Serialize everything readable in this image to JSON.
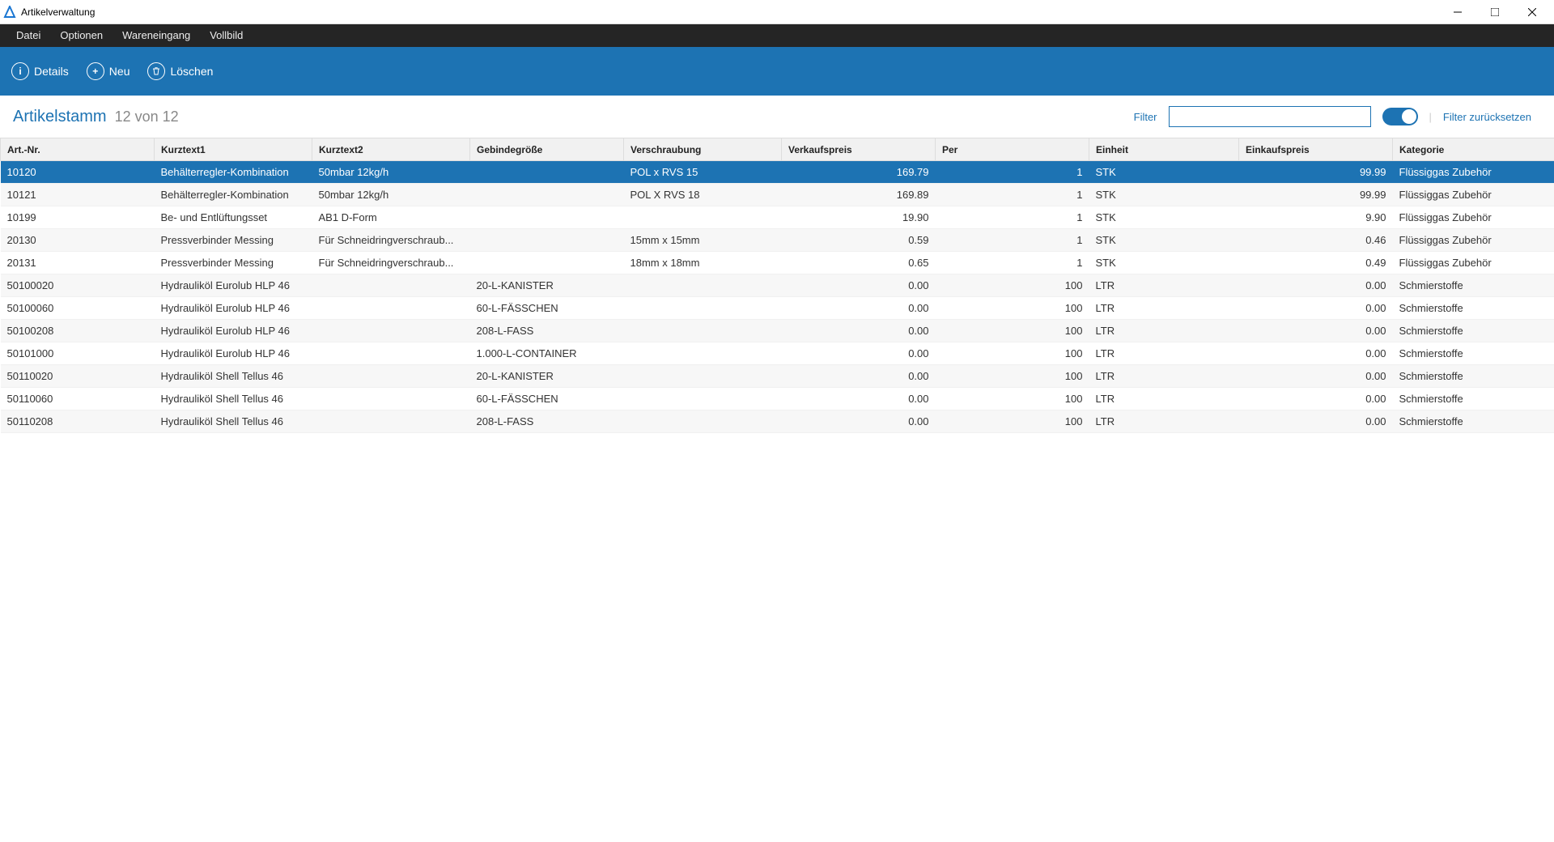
{
  "window": {
    "title": "Artikelverwaltung"
  },
  "menu": [
    "Datei",
    "Optionen",
    "Wareneingang",
    "Vollbild"
  ],
  "toolbar": {
    "details": "Details",
    "neu": "Neu",
    "loeschen": "Löschen"
  },
  "header": {
    "title": "Artikelstamm",
    "count": "12 von 12",
    "filter_label": "Filter",
    "filter_value": "",
    "reset": "Filter zurücksetzen"
  },
  "table": {
    "columns": [
      "Art.-Nr.",
      "Kurztext1",
      "Kurztext2",
      "Gebindegröße",
      "Verschraubung",
      "Verkaufspreis",
      "Per",
      "Einheit",
      "Einkaufspreis",
      "Kategorie"
    ],
    "rows": [
      {
        "art": "10120",
        "k1": "Behälterregler-Kombination",
        "k2": "50mbar 12kg/h",
        "geb": "",
        "ver": "POL x RVS 15",
        "vp": "169.79",
        "per": "1",
        "ein": "STK",
        "ep": "99.99",
        "kat": "Flüssiggas Zubehör",
        "selected": true
      },
      {
        "art": "10121",
        "k1": "Behälterregler-Kombination",
        "k2": "50mbar 12kg/h",
        "geb": "",
        "ver": "POL X RVS 18",
        "vp": "169.89",
        "per": "1",
        "ein": "STK",
        "ep": "99.99",
        "kat": "Flüssiggas Zubehör"
      },
      {
        "art": "10199",
        "k1": "Be- und Entlüftungsset",
        "k2": "AB1 D-Form",
        "geb": "",
        "ver": "",
        "vp": "19.90",
        "per": "1",
        "ein": "STK",
        "ep": "9.90",
        "kat": "Flüssiggas Zubehör"
      },
      {
        "art": "20130",
        "k1": "Pressverbinder Messing",
        "k2": "Für Schneidringverschraub...",
        "geb": "",
        "ver": "15mm x 15mm",
        "vp": "0.59",
        "per": "1",
        "ein": "STK",
        "ep": "0.46",
        "kat": "Flüssiggas Zubehör"
      },
      {
        "art": "20131",
        "k1": "Pressverbinder Messing",
        "k2": "Für Schneidringverschraub...",
        "geb": "",
        "ver": "18mm x 18mm",
        "vp": "0.65",
        "per": "1",
        "ein": "STK",
        "ep": "0.49",
        "kat": "Flüssiggas Zubehör"
      },
      {
        "art": "50100020",
        "k1": "Hydrauliköl Eurolub HLP 46",
        "k2": "",
        "geb": "20-L-KANISTER",
        "ver": "",
        "vp": "0.00",
        "per": "100",
        "ein": "LTR",
        "ep": "0.00",
        "kat": "Schmierstoffe"
      },
      {
        "art": "50100060",
        "k1": "Hydrauliköl Eurolub HLP 46",
        "k2": "",
        "geb": "60-L-FÄSSCHEN",
        "ver": "",
        "vp": "0.00",
        "per": "100",
        "ein": "LTR",
        "ep": "0.00",
        "kat": "Schmierstoffe"
      },
      {
        "art": "50100208",
        "k1": "Hydrauliköl Eurolub HLP 46",
        "k2": "",
        "geb": "208-L-FASS",
        "ver": "",
        "vp": "0.00",
        "per": "100",
        "ein": "LTR",
        "ep": "0.00",
        "kat": "Schmierstoffe"
      },
      {
        "art": "50101000",
        "k1": "Hydrauliköl Eurolub HLP 46",
        "k2": "",
        "geb": "1.000-L-CONTAINER",
        "ver": "",
        "vp": "0.00",
        "per": "100",
        "ein": "LTR",
        "ep": "0.00",
        "kat": "Schmierstoffe"
      },
      {
        "art": "50110020",
        "k1": "Hydrauliköl Shell Tellus 46",
        "k2": "",
        "geb": "20-L-KANISTER",
        "ver": "",
        "vp": "0.00",
        "per": "100",
        "ein": "LTR",
        "ep": "0.00",
        "kat": "Schmierstoffe"
      },
      {
        "art": "50110060",
        "k1": "Hydrauliköl Shell Tellus 46",
        "k2": "",
        "geb": "60-L-FÄSSCHEN",
        "ver": "",
        "vp": "0.00",
        "per": "100",
        "ein": "LTR",
        "ep": "0.00",
        "kat": "Schmierstoffe"
      },
      {
        "art": "50110208",
        "k1": "Hydrauliköl Shell Tellus 46",
        "k2": "",
        "geb": "208-L-FASS",
        "ver": "",
        "vp": "0.00",
        "per": "100",
        "ein": "LTR",
        "ep": "0.00",
        "kat": "Schmierstoffe"
      }
    ]
  }
}
